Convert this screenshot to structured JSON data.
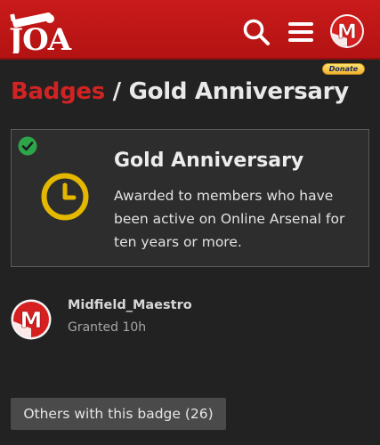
{
  "header": {
    "logo_text": "JOA",
    "search_icon": "search-icon",
    "menu_icon": "hamburger-menu-icon",
    "avatar_letter": "M"
  },
  "donate": {
    "label": "Donate"
  },
  "title": {
    "crumb": "Badges",
    "separator": " / ",
    "current": "Gold Anniversary"
  },
  "badge": {
    "name": "Gold Anniversary",
    "description": "Awarded to members who have been active on Online Arsenal for ten years or more.",
    "status_icon": "check-circle-icon",
    "icon": "clock-icon"
  },
  "granted_to": {
    "username": "Midfield_Maestro",
    "granted_text": "Granted 10h",
    "avatar_letter": "M"
  },
  "others_button": {
    "label": "Others with this badge (26)"
  },
  "colors": {
    "header_red": "#c91a1a",
    "crumb_red": "#d12323",
    "background": "#222222",
    "card": "#2d2d2d",
    "badge_gold": "#e4b800",
    "check_green": "#2ea54b"
  }
}
